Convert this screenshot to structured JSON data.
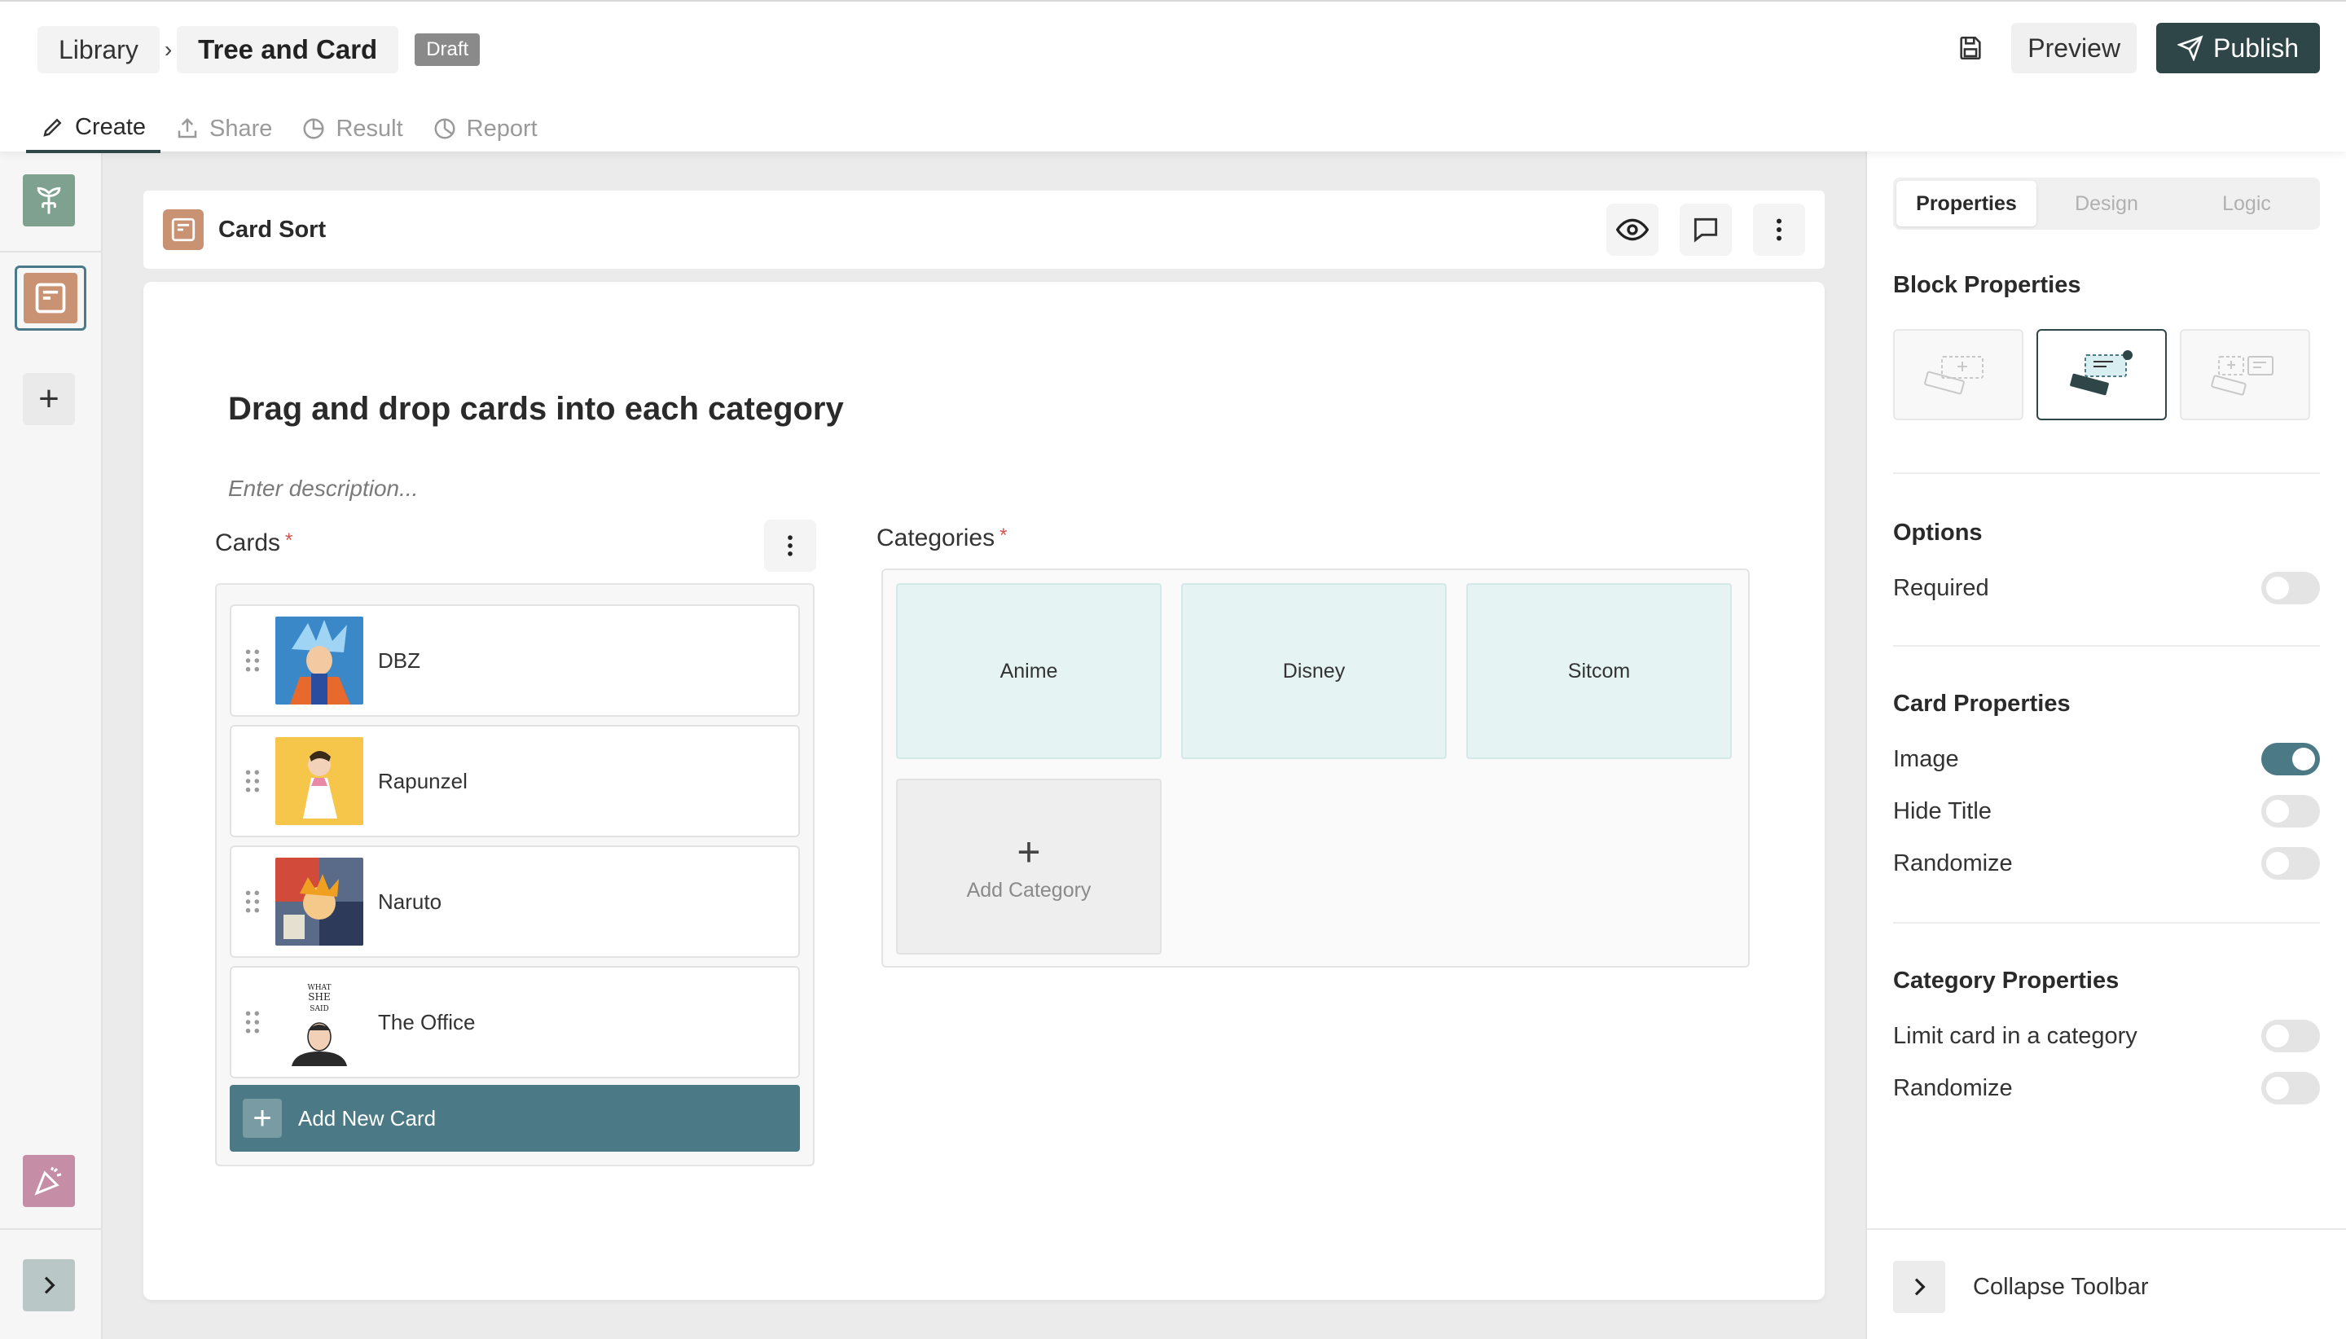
{
  "breadcrumb": {
    "root": "Library",
    "separator": "›",
    "current": "Tree and Card",
    "status_badge": "Draft"
  },
  "header_actions": {
    "save_icon": "save-icon",
    "preview_label": "Preview",
    "publish_label": "Publish"
  },
  "tabs": [
    {
      "label": "Create",
      "icon": "pencil-icon",
      "active": true
    },
    {
      "label": "Share",
      "icon": "share-icon",
      "active": false
    },
    {
      "label": "Result",
      "icon": "pie-chart-icon",
      "active": false
    },
    {
      "label": "Report",
      "icon": "report-icon",
      "active": false
    }
  ],
  "left_rail": {
    "add_label": "+"
  },
  "block": {
    "title": "Card Sort"
  },
  "question": {
    "title": "Drag and drop cards into each category",
    "description_placeholder": "Enter description..."
  },
  "cards": {
    "label": "Cards",
    "required_mark": "*",
    "items": [
      {
        "name": "DBZ"
      },
      {
        "name": "Rapunzel"
      },
      {
        "name": "Naruto"
      },
      {
        "name": "The Office"
      }
    ],
    "add_button": "Add New Card",
    "office_thumb_text": [
      "WHAT",
      "SHE",
      "SAID"
    ]
  },
  "categories": {
    "label": "Categories",
    "required_mark": "*",
    "items": [
      "Anime",
      "Disney",
      "Sitcom"
    ],
    "add_label": "Add Category"
  },
  "sidebar": {
    "tabs": [
      "Properties",
      "Design",
      "Logic"
    ],
    "block_properties_heading": "Block Properties",
    "options_heading": "Options",
    "options": [
      {
        "label": "Required",
        "on": false
      }
    ],
    "card_properties_heading": "Card Properties",
    "card_properties": [
      {
        "label": "Image",
        "on": true
      },
      {
        "label": "Hide Title",
        "on": false
      },
      {
        "label": "Randomize",
        "on": false
      }
    ],
    "category_properties_heading": "Category Properties",
    "category_properties": [
      {
        "label": "Limit card in a category",
        "on": false
      },
      {
        "label": "Randomize",
        "on": false
      }
    ],
    "collapse_label": "Collapse Toolbar"
  },
  "colors": {
    "primary": "#2f4648",
    "accent": "#4b7a86",
    "category_tile": "#e5f3f3",
    "card_icon": "#c99272"
  }
}
